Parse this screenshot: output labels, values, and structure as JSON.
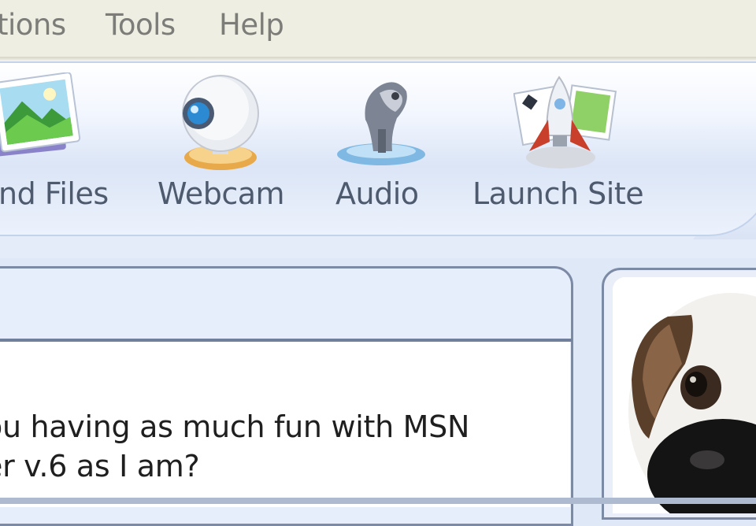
{
  "menu": {
    "items": [
      {
        "label": "tions"
      },
      {
        "label": "Tools"
      },
      {
        "label": "Help"
      }
    ]
  },
  "toolbar": {
    "buttons": [
      {
        "label": "nd Files",
        "icon": "photo-icon"
      },
      {
        "label": "Webcam",
        "icon": "webcam-icon"
      },
      {
        "label": "Audio",
        "icon": "microphone-icon"
      },
      {
        "label": "Launch Site",
        "icon": "rocket-icon"
      }
    ]
  },
  "conversation": {
    "lines": [
      ":",
      "ou having as much fun with MSN",
      "er v.6 as I am?"
    ]
  },
  "display_picture": {
    "icon": "dog-avatar"
  },
  "colors": {
    "menubar": "#efeee2",
    "menu_text": "#7c7c78",
    "toolbar_text": "#4e5a6e",
    "panel_border": "#7c8aa5"
  }
}
